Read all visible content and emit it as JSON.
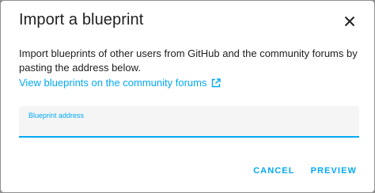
{
  "dialog": {
    "title": "Import a blueprint",
    "close_icon": "close-icon",
    "description": "Import blueprints of other users from GitHub and the community forums by pasting the address below.",
    "community_link": {
      "label": "View blueprints on the community forums",
      "icon": "open-in-new-icon"
    },
    "address_field": {
      "label": "Blueprint address",
      "value": ""
    },
    "actions": {
      "cancel_label": "CANCEL",
      "preview_label": "PREVIEW"
    }
  },
  "colors": {
    "accent": "#03a9f4",
    "text": "#212121",
    "field_bg": "#f5f5f5"
  }
}
